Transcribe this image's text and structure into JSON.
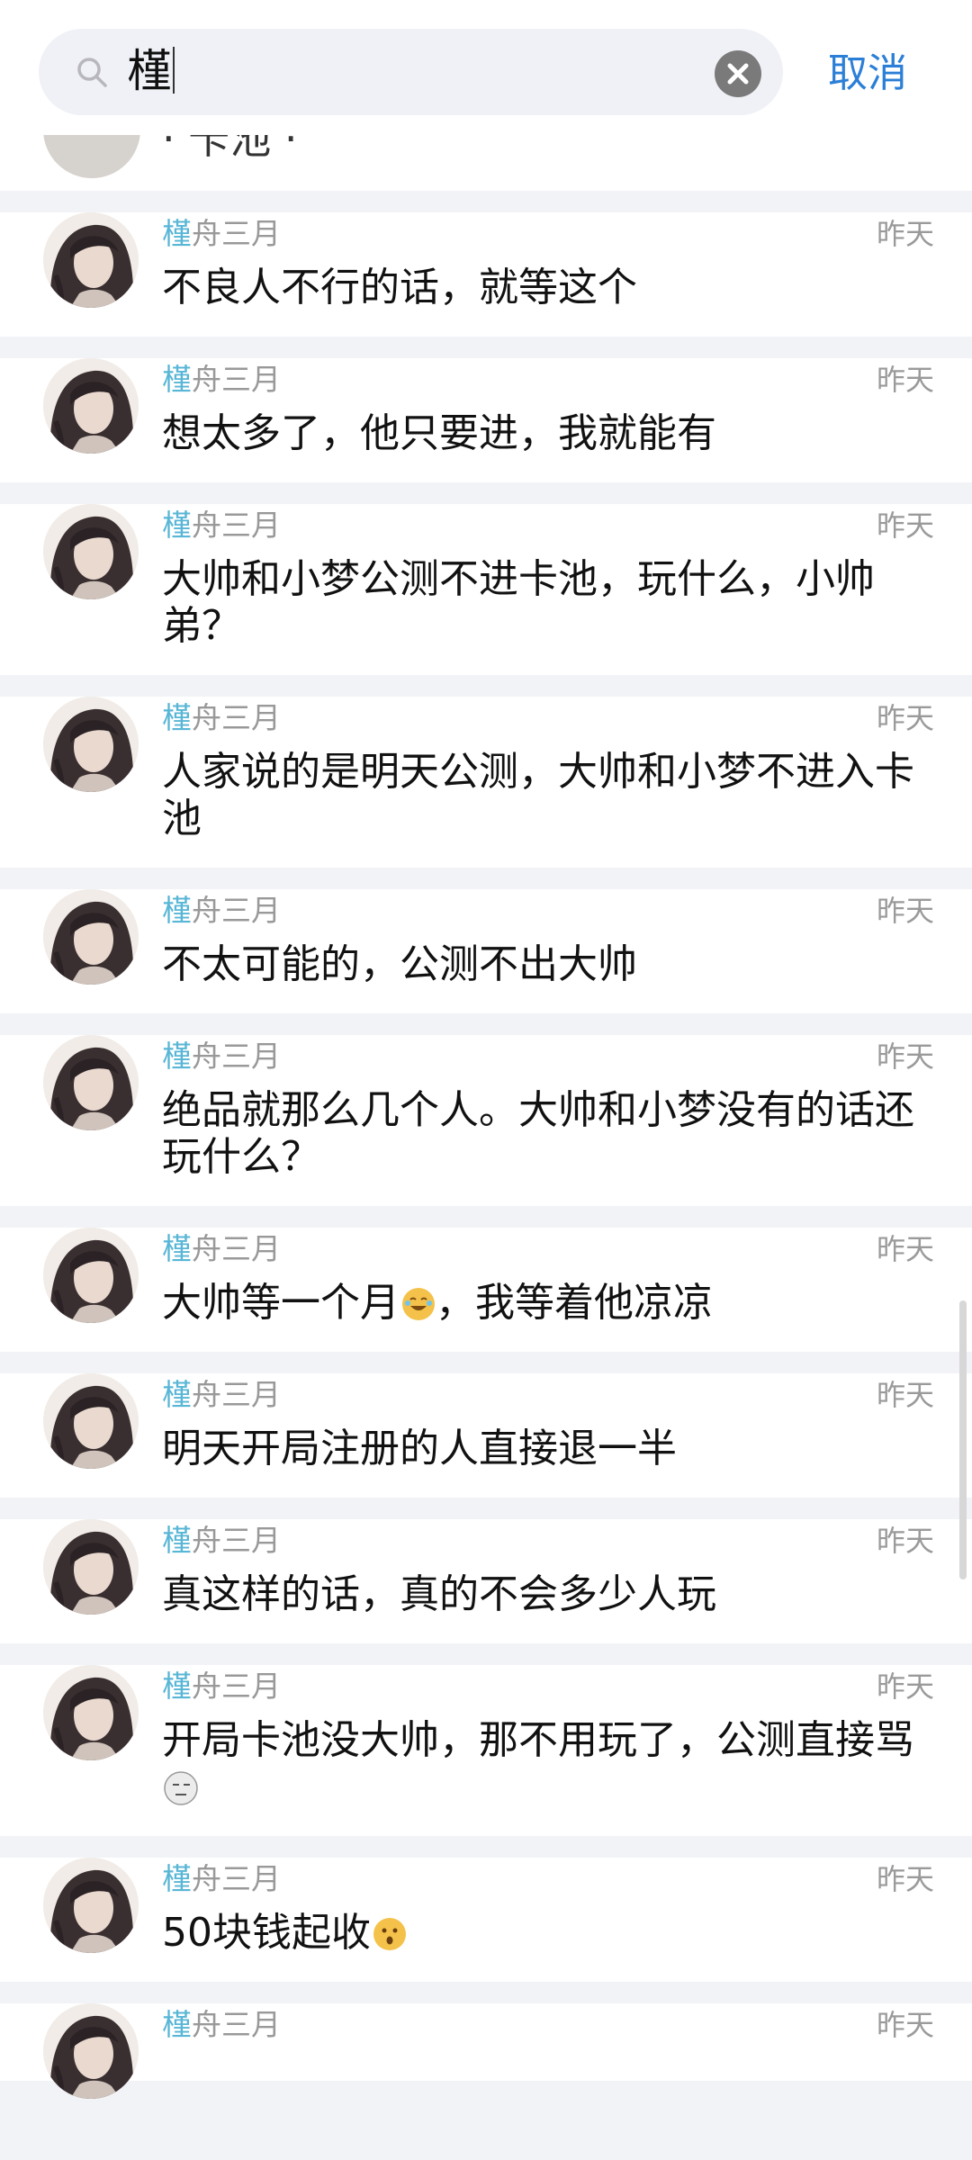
{
  "search": {
    "query": "槿",
    "cancel_label": "取消"
  },
  "partial_item": {
    "text": "· 卡池 ·"
  },
  "results": [
    {
      "name_hl": "槿",
      "name_rest": "舟三月",
      "time": "昨天",
      "text": "不良人不行的话，就等这个"
    },
    {
      "name_hl": "槿",
      "name_rest": "舟三月",
      "time": "昨天",
      "text": "想太多了，他只要进，我就能有"
    },
    {
      "name_hl": "槿",
      "name_rest": "舟三月",
      "time": "昨天",
      "text": "大帅和小梦公测不进卡池，玩什么，小帅弟？"
    },
    {
      "name_hl": "槿",
      "name_rest": "舟三月",
      "time": "昨天",
      "text": "人家说的是明天公测，大帅和小梦不进入卡池"
    },
    {
      "name_hl": "槿",
      "name_rest": "舟三月",
      "time": "昨天",
      "text": "不太可能的，公测不出大帅"
    },
    {
      "name_hl": "槿",
      "name_rest": "舟三月",
      "time": "昨天",
      "text": "绝品就那么几个人。大帅和小梦没有的话还玩什么？"
    },
    {
      "name_hl": "槿",
      "name_rest": "舟三月",
      "time": "昨天",
      "text_before": "大帅等一个月",
      "emoji": "laugh-tears-emoji",
      "text_after": "，我等着他凉凉"
    },
    {
      "name_hl": "槿",
      "name_rest": "舟三月",
      "time": "昨天",
      "text": "明天开局注册的人直接退一半"
    },
    {
      "name_hl": "槿",
      "name_rest": "舟三月",
      "time": "昨天",
      "text": "真这样的话，真的不会多少人玩"
    },
    {
      "name_hl": "槿",
      "name_rest": "舟三月",
      "time": "昨天",
      "text_before": "开局卡池没大帅，那不用玩了，公测直接骂",
      "emoji": "speechless-emoji"
    },
    {
      "name_hl": "槿",
      "name_rest": "舟三月",
      "time": "昨天",
      "text_before": "50块钱起收",
      "emoji": "surprised-emoji"
    },
    {
      "name_hl": "槿",
      "name_rest": "舟三月",
      "time": "昨天",
      "text": ""
    }
  ],
  "colors": {
    "accent": "#2b7fd6",
    "highlight": "#58b6d6",
    "muted": "#9a9a9a"
  }
}
